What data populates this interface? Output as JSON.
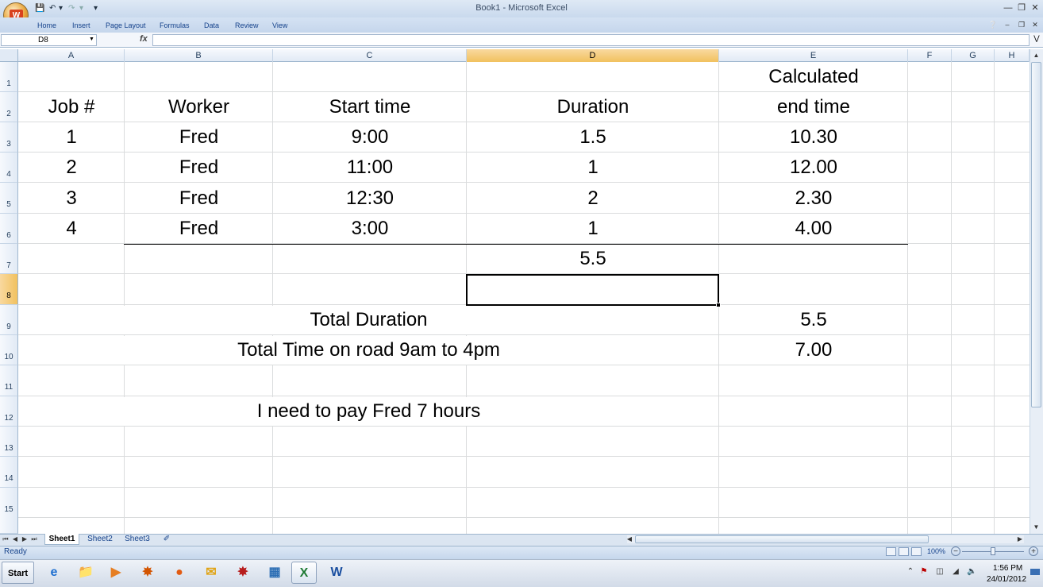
{
  "window": {
    "title": "Book1 - Microsoft Excel",
    "office_logo": "W",
    "qat_icons": [
      "save-icon",
      "undo-icon",
      "redo-icon",
      "customize-icon"
    ],
    "controls": [
      "minimize-icon",
      "restore-icon",
      "close-icon"
    ]
  },
  "ribbon": {
    "tabs": [
      "Home",
      "Insert",
      "Page Layout",
      "Formulas",
      "Data",
      "Review",
      "View"
    ]
  },
  "formula_bar": {
    "name_box": "D8",
    "fx_label": "fx",
    "formula": ""
  },
  "grid": {
    "columns": [
      "A",
      "B",
      "C",
      "D",
      "E",
      "F",
      "G",
      "H"
    ],
    "selected_column": "D",
    "rows": [
      "1",
      "2",
      "3",
      "4",
      "5",
      "6",
      "7",
      "8",
      "9",
      "10",
      "11",
      "12",
      "13",
      "14",
      "15"
    ],
    "selected_row": "8",
    "cells": {
      "E1": "Calculated",
      "A2": "Job #",
      "B2": "Worker",
      "C2": "Start time",
      "D2": "Duration",
      "E2": "end time",
      "A3": "1",
      "B3": "Fred",
      "C3": "9:00",
      "D3": "1.5",
      "E3": "10.30",
      "A4": "2",
      "B4": "Fred",
      "C4": "11:00",
      "D4": "1",
      "E4": "12.00",
      "A5": "3",
      "B5": "Fred",
      "C5": "12:30",
      "D5": "2",
      "E5": "2.30",
      "A6": "4",
      "B6": "Fred",
      "C6": "3:00",
      "D6": "1",
      "E6": "4.00",
      "D7": "5.5",
      "C9": "Total Duration",
      "E9": "5.5",
      "C10": "Total Time on road 9am to 4pm",
      "E10": "7.00",
      "C12": "I need to pay Fred 7 hours"
    }
  },
  "sheets": {
    "tabs": [
      "Sheet1",
      "Sheet2",
      "Sheet3"
    ],
    "active": "Sheet1"
  },
  "status_bar": {
    "status": "Ready",
    "zoom": "100%",
    "zoom_level_fraction": 0.5
  },
  "taskbar": {
    "start_label": "Start",
    "apps": [
      "internet-explorer-icon",
      "file-explorer-icon",
      "media-player-icon",
      "app-icon",
      "firefox-icon",
      "outlook-icon",
      "acrobat-icon",
      "network-icon",
      "excel-icon",
      "word-icon"
    ],
    "clock_time": "1:56 PM",
    "clock_date": "24/01/2012"
  }
}
